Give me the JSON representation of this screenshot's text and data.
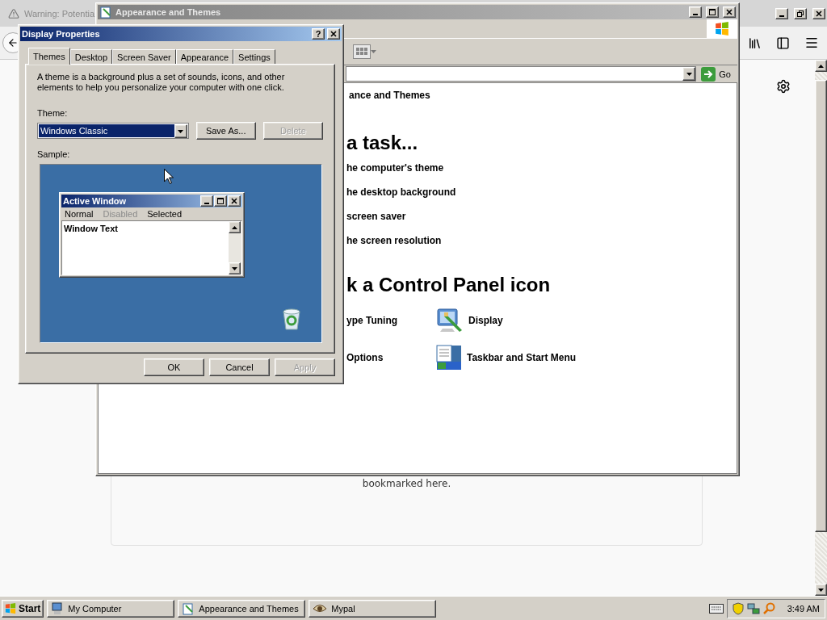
{
  "browser": {
    "title": "Warning: Potentia",
    "content_text": "bookmarked here."
  },
  "explorer": {
    "title": "Appearance and Themes",
    "go": "Go",
    "breadcrumb": "ance and Themes",
    "task_heading": "a task...",
    "tasks": [
      "he computer's theme",
      "he desktop background",
      " screen saver",
      "he screen resolution"
    ],
    "icon_heading": "k a Control Panel icon",
    "icons": [
      {
        "label": "ype Tuning",
        "kind": "text"
      },
      {
        "label": "Display",
        "kind": "display"
      },
      {
        "label": "Options",
        "kind": "text"
      },
      {
        "label": "Taskbar and Start Menu",
        "kind": "taskbar"
      }
    ]
  },
  "dialog": {
    "title": "Display Properties",
    "help": "?",
    "tabs": [
      {
        "label": "Themes",
        "selected": true
      },
      {
        "label": "Desktop",
        "selected": false
      },
      {
        "label": "Screen Saver",
        "selected": false
      },
      {
        "label": "Appearance",
        "selected": false
      },
      {
        "label": "Settings",
        "selected": false
      }
    ],
    "description": "A theme is a background plus a set of sounds, icons, and other elements to help you personalize your computer with one click.",
    "theme_label": "Theme:",
    "theme_value": "Windows Classic",
    "theme_buttons": [
      {
        "label": "Save As...",
        "disabled": false
      },
      {
        "label": "Delete",
        "disabled": true
      }
    ],
    "sample_label": "Sample:",
    "sample": {
      "title": "Active Window",
      "menu": [
        {
          "label": "Normal",
          "kind": "normal"
        },
        {
          "label": "Disabled",
          "kind": "disabled"
        },
        {
          "label": "Selected",
          "kind": "selected"
        }
      ],
      "text": "Window Text"
    },
    "buttons": [
      {
        "label": "OK",
        "disabled": false
      },
      {
        "label": "Cancel",
        "disabled": false
      },
      {
        "label": "Apply",
        "disabled": true
      }
    ]
  },
  "taskbar": {
    "start": "Start",
    "items": [
      {
        "label": "My Computer",
        "kind": "computer"
      },
      {
        "label": "Appearance and Themes",
        "kind": "document"
      },
      {
        "label": "Mypal",
        "kind": "eye"
      }
    ],
    "clock": "3:49 AM"
  }
}
